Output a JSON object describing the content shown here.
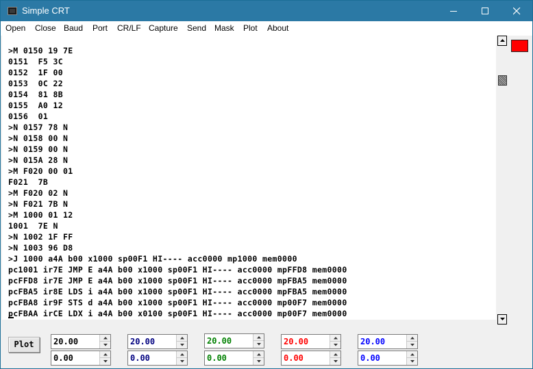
{
  "window": {
    "title": "Simple CRT",
    "icon": "terminal-icon",
    "controls": {
      "minimize": "minimize-icon",
      "maximize": "maximize-icon",
      "close": "close-icon"
    }
  },
  "menu": [
    "Open",
    "Close",
    "Baud",
    "Port",
    "CR/LF",
    "Capture",
    "Send",
    "Mask",
    "Plot",
    "About"
  ],
  "terminal": {
    "lines": [
      ">M 0150 19 7E",
      "0151  F5 3C",
      "0152  1F 00",
      "0153  0C 22",
      "0154  81 8B",
      "0155  A0 12",
      "0156  01",
      ">N 0157 78 N",
      ">N 0158 00 N",
      ">N 0159 00 N",
      ">N 015A 28 N",
      ">M F020 00 01",
      "F021  7B",
      ">M F020 02 N",
      ">N F021 7B N",
      ">M 1000 01 12",
      "1001  7E N",
      ">N 1002 1F FF",
      ">N 1003 96 D8",
      ">J 1000 a4A b00 x1000 sp00F1 HI---- acc0000 mp1000 mem0000",
      "pc1001 ir7E JMP E a4A b00 x1000 sp00F1 HI---- acc0000 mpFFD8 mem0000",
      "pcFFD8 ir7E JMP E a4A b00 x1000 sp00F1 HI---- acc0000 mpFBA5 mem0000",
      "pcFBA5 ir8E LDS i a4A b00 x1000 sp00F1 HI---- acc0000 mpFBA5 mem0000",
      "pcFBA8 ir9F STS d a4A b00 x1000 sp00F1 HI---- acc0000 mp00F7 mem0000",
      "pcFBAA irCE LDX i a4A b00 x0100 sp00F1 HI---- acc0000 mp00F7 mem0000"
    ],
    "text_color": "#000000",
    "background": "#ffffff"
  },
  "status_indicator": {
    "color": "#ff0000"
  },
  "plot": {
    "button_label": "Plot",
    "max_values": [
      {
        "value": "20.00",
        "color": "#000000"
      },
      {
        "value": "20.00",
        "color": "#000080"
      },
      {
        "value": "20.00",
        "color": "#008000"
      },
      {
        "value": "20.00",
        "color": "#ff0000"
      },
      {
        "value": "20.00",
        "color": "#0000ff"
      }
    ],
    "min_values": [
      {
        "value": "0.00",
        "color": "#000000"
      },
      {
        "value": "0.00",
        "color": "#000080"
      },
      {
        "value": "0.00",
        "color": "#008000"
      },
      {
        "value": "0.00",
        "color": "#ff0000"
      },
      {
        "value": "0.00",
        "color": "#0000ff"
      }
    ]
  }
}
